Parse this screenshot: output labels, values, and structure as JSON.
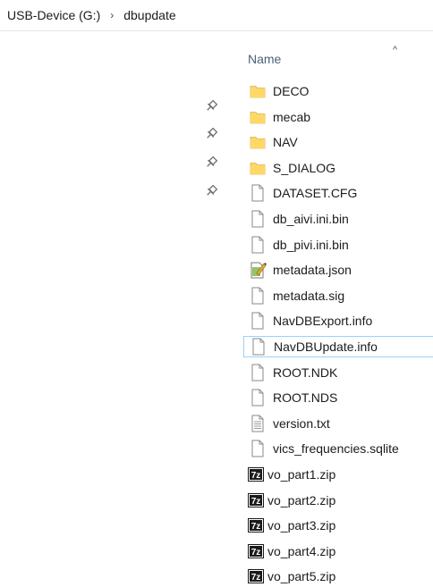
{
  "breadcrumb": {
    "drive": "USB-Device (G:)",
    "separator": "›",
    "folder": "dbupdate"
  },
  "header": {
    "column_name": "Name",
    "sort_arrow": "^"
  },
  "files": [
    {
      "name": "DECO",
      "type": "folder"
    },
    {
      "name": "mecab",
      "type": "folder"
    },
    {
      "name": "NAV",
      "type": "folder"
    },
    {
      "name": "S_DIALOG",
      "type": "folder"
    },
    {
      "name": "DATASET.CFG",
      "type": "file"
    },
    {
      "name": "db_aivi.ini.bin",
      "type": "file"
    },
    {
      "name": "db_pivi.ini.bin",
      "type": "file"
    },
    {
      "name": "metadata.json",
      "type": "json"
    },
    {
      "name": "metadata.sig",
      "type": "file"
    },
    {
      "name": "NavDBExport.info",
      "type": "file"
    },
    {
      "name": "NavDBUpdate.info",
      "type": "file",
      "selected": true
    },
    {
      "name": "ROOT.NDK",
      "type": "file"
    },
    {
      "name": "ROOT.NDS",
      "type": "file"
    },
    {
      "name": "version.txt",
      "type": "text"
    },
    {
      "name": "vics_frequencies.sqlite",
      "type": "file"
    },
    {
      "name": "vo_part1.zip",
      "type": "zip"
    },
    {
      "name": "vo_part2.zip",
      "type": "zip"
    },
    {
      "name": "vo_part3.zip",
      "type": "zip"
    },
    {
      "name": "vo_part4.zip",
      "type": "zip"
    },
    {
      "name": "vo_part5.zip",
      "type": "zip"
    }
  ],
  "icons": {
    "folder": "folder-icon",
    "file": "file-icon",
    "json": "json-file-icon",
    "text": "text-file-icon",
    "zip": "7zip-archive-icon",
    "pin": "pin-icon"
  },
  "colors": {
    "folder": "#f8d775",
    "selection_border": "#99d1ff",
    "header_text": "#4c607a"
  }
}
